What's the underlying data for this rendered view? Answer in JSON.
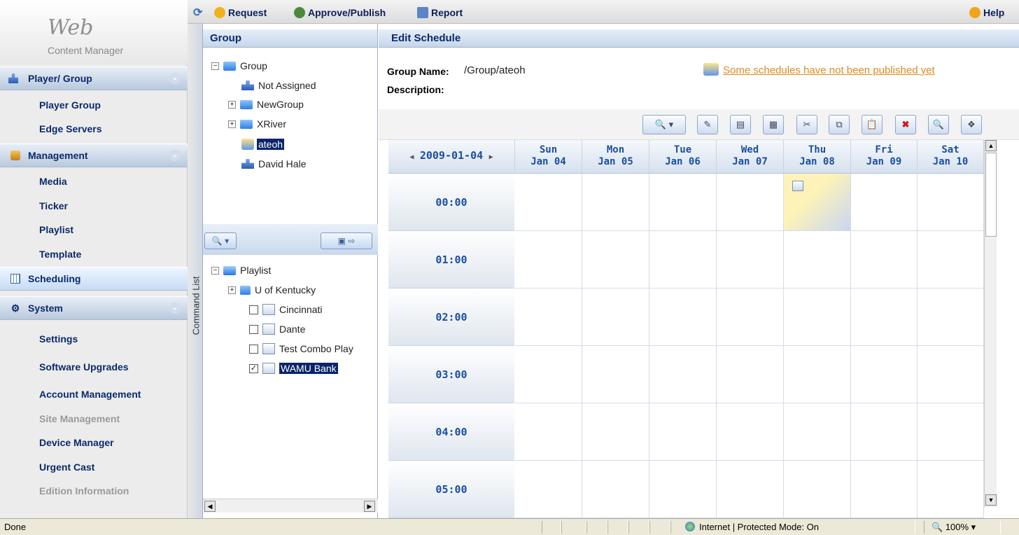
{
  "sidebar": {
    "brand_title": "Web",
    "brand_subtitle": "Content Manager",
    "sections": [
      {
        "label": "Player/ Group"
      },
      {
        "label": "Management"
      },
      {
        "label": "Scheduling"
      },
      {
        "label": "System"
      }
    ],
    "player_items": [
      "Player Group",
      "Edge Servers"
    ],
    "management_items": [
      "Media",
      "Ticker",
      "Playlist",
      "Template"
    ],
    "system_items": [
      "Settings",
      "Software Upgrades",
      "Account Management",
      "Site Management",
      "Device Manager",
      "Urgent Cast",
      "Edition Information"
    ]
  },
  "toolbar": {
    "request": "Request",
    "approve": "Approve/Publish",
    "report": "Report",
    "help": "Help"
  },
  "command_list": "Command List",
  "group_panel": {
    "title": "Group",
    "tree": [
      "Group",
      "Not Assigned",
      "NewGroup",
      "XRiver",
      "ateoh",
      "David Hale"
    ],
    "playlist_tree": [
      "Playlist",
      "U of Kentucky",
      "Cincinnati",
      "Dante",
      "Test Combo Play",
      "WAMU Bank"
    ]
  },
  "schedule": {
    "title": "Edit Schedule",
    "group_name_label": "Group Name:",
    "group_name_value": "/Group/ateoh",
    "description_label": "Description:",
    "warning": "Some schedules have not been published yet",
    "week_date": "2009-01-04",
    "days": [
      {
        "d": "Sun",
        "n": "Jan 04"
      },
      {
        "d": "Mon",
        "n": "Jan 05"
      },
      {
        "d": "Tue",
        "n": "Jan 06"
      },
      {
        "d": "Wed",
        "n": "Jan 07"
      },
      {
        "d": "Thu",
        "n": "Jan 08"
      },
      {
        "d": "Fri",
        "n": "Jan 09"
      },
      {
        "d": "Sat",
        "n": "Jan 10"
      }
    ],
    "times": [
      "00:00",
      "01:00",
      "02:00",
      "03:00",
      "04:00",
      "05:00"
    ]
  },
  "status_bar": {
    "left": "Done",
    "zone": "Internet | Protected Mode: On",
    "zoom": "100%"
  },
  "colors": {
    "accent": "#0b2a6b",
    "selection": "#0a246a",
    "warning": "#e08a1e",
    "event": "#fbf3bf"
  }
}
